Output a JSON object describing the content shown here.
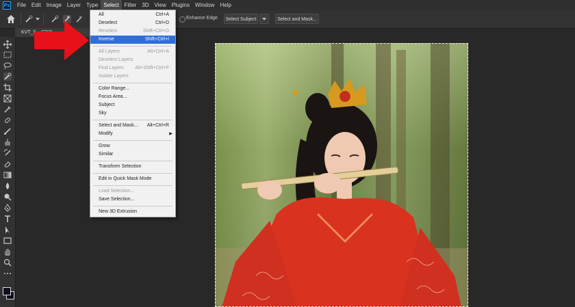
{
  "app": {
    "logo_text": "Ps"
  },
  "menubar": {
    "items": [
      "File",
      "Edit",
      "Image",
      "Layer",
      "Type",
      "Select",
      "Filter",
      "3D",
      "View",
      "Plugins",
      "Window",
      "Help"
    ],
    "active": "Select"
  },
  "options": {
    "enhance_edge_label": "Enhance Edge",
    "select_subject_label": "Select Subject",
    "select_and_mask_label": "Select and Mask..."
  },
  "document": {
    "tab_label": "KVT_9...           GB/8"
  },
  "select_menu": {
    "items": [
      {
        "label": "All",
        "shortcut": "Ctrl+A",
        "state": "enabled"
      },
      {
        "label": "Deselect",
        "shortcut": "Ctrl+D",
        "state": "enabled"
      },
      {
        "label": "Reselect",
        "shortcut": "Shift+Ctrl+D",
        "state": "disabled"
      },
      {
        "label": "Inverse",
        "shortcut": "Shift+Ctrl+I",
        "state": "highlighted"
      },
      {
        "label": "All Layers",
        "shortcut": "Alt+Ctrl+A",
        "state": "disabled"
      },
      {
        "label": "Deselect Layers",
        "shortcut": "",
        "state": "disabled"
      },
      {
        "label": "Find Layers",
        "shortcut": "Alt+Shift+Ctrl+F",
        "state": "disabled"
      },
      {
        "label": "Isolate Layers",
        "shortcut": "",
        "state": "disabled"
      },
      {
        "label": "Color Range...",
        "shortcut": "",
        "state": "enabled"
      },
      {
        "label": "Focus Area...",
        "shortcut": "",
        "state": "enabled"
      },
      {
        "label": "Subject",
        "shortcut": "",
        "state": "enabled"
      },
      {
        "label": "Sky",
        "shortcut": "",
        "state": "enabled"
      },
      {
        "label": "Select and Mask...",
        "shortcut": "Alt+Ctrl+R",
        "state": "enabled"
      },
      {
        "label": "Modify",
        "shortcut": "",
        "state": "enabled",
        "submenu": true
      },
      {
        "label": "Grow",
        "shortcut": "",
        "state": "enabled"
      },
      {
        "label": "Similar",
        "shortcut": "",
        "state": "enabled"
      },
      {
        "label": "Transform Selection",
        "shortcut": "",
        "state": "enabled"
      },
      {
        "label": "Edit in Quick Mask Mode",
        "shortcut": "",
        "state": "enabled"
      },
      {
        "label": "Load Selection...",
        "shortcut": "",
        "state": "disabled"
      },
      {
        "label": "Save Selection...",
        "shortcut": "",
        "state": "enabled"
      },
      {
        "label": "New 3D Extrusion",
        "shortcut": "",
        "state": "enabled"
      }
    ]
  },
  "colors": {
    "highlight": "#2f6fd6",
    "annotation_arrow": "#e8101a",
    "dress": "#d9321e"
  },
  "icons": {
    "tools": [
      "move-icon",
      "marquee-icon",
      "lasso-icon",
      "quick-selection-icon",
      "crop-icon",
      "frame-icon",
      "eyedropper-icon",
      "healing-brush-icon",
      "brush-icon",
      "clone-stamp-icon",
      "history-brush-icon",
      "eraser-icon",
      "gradient-icon",
      "blur-icon",
      "dodge-icon",
      "pen-icon",
      "type-icon",
      "path-selection-icon",
      "rectangle-icon",
      "hand-icon",
      "zoom-icon",
      "more-tools-icon"
    ]
  }
}
